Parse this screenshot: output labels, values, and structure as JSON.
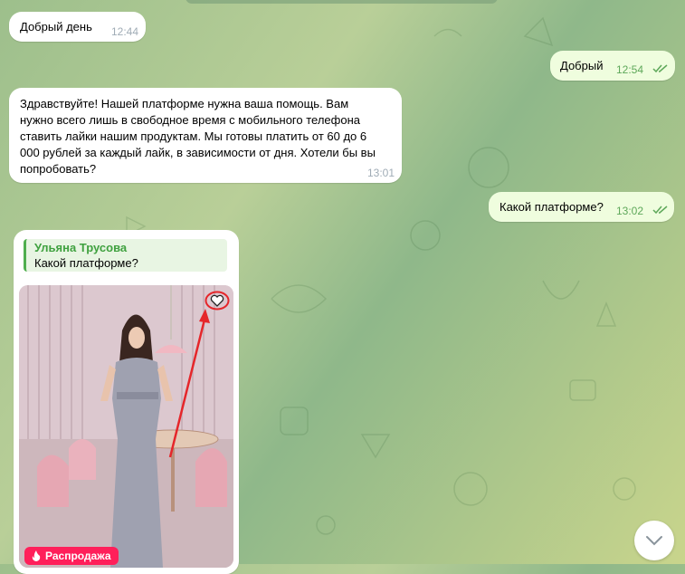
{
  "messages": [
    {
      "text": "Добрый день",
      "time": "12:44"
    },
    {
      "text": "Добрый",
      "time": "12:54"
    },
    {
      "text": "Здравствуйте! Нашей платформе нужна ваша помощь. Вам\nнужно всего лишь в свободное время с мобильного телефона\nставить лайки нашим продуктам. Мы готовы платить от 60 до 6\n000 рублей за каждый лайк, в зависимости от дня. Хотели бы вы\nпопробовать?",
      "time": "13:01"
    },
    {
      "text": "Какой платформе?",
      "time": "13:02"
    }
  ],
  "reply_card": {
    "reply_name": "Ульяна Трусова",
    "reply_text": "Какой платформе?",
    "sale_badge": "Распродажа"
  },
  "icons": {
    "read_check": "double-check-icon",
    "like": "heart-icon",
    "sale": "fire-icon",
    "scroll": "chevron-down-icon"
  },
  "colors": {
    "incoming_bubble": "#ffffff",
    "outgoing_bubble": "#effdde",
    "reply_accent": "#4fae4e",
    "sale_badge": "#ff1f5a",
    "arrow": "#e5262a"
  }
}
